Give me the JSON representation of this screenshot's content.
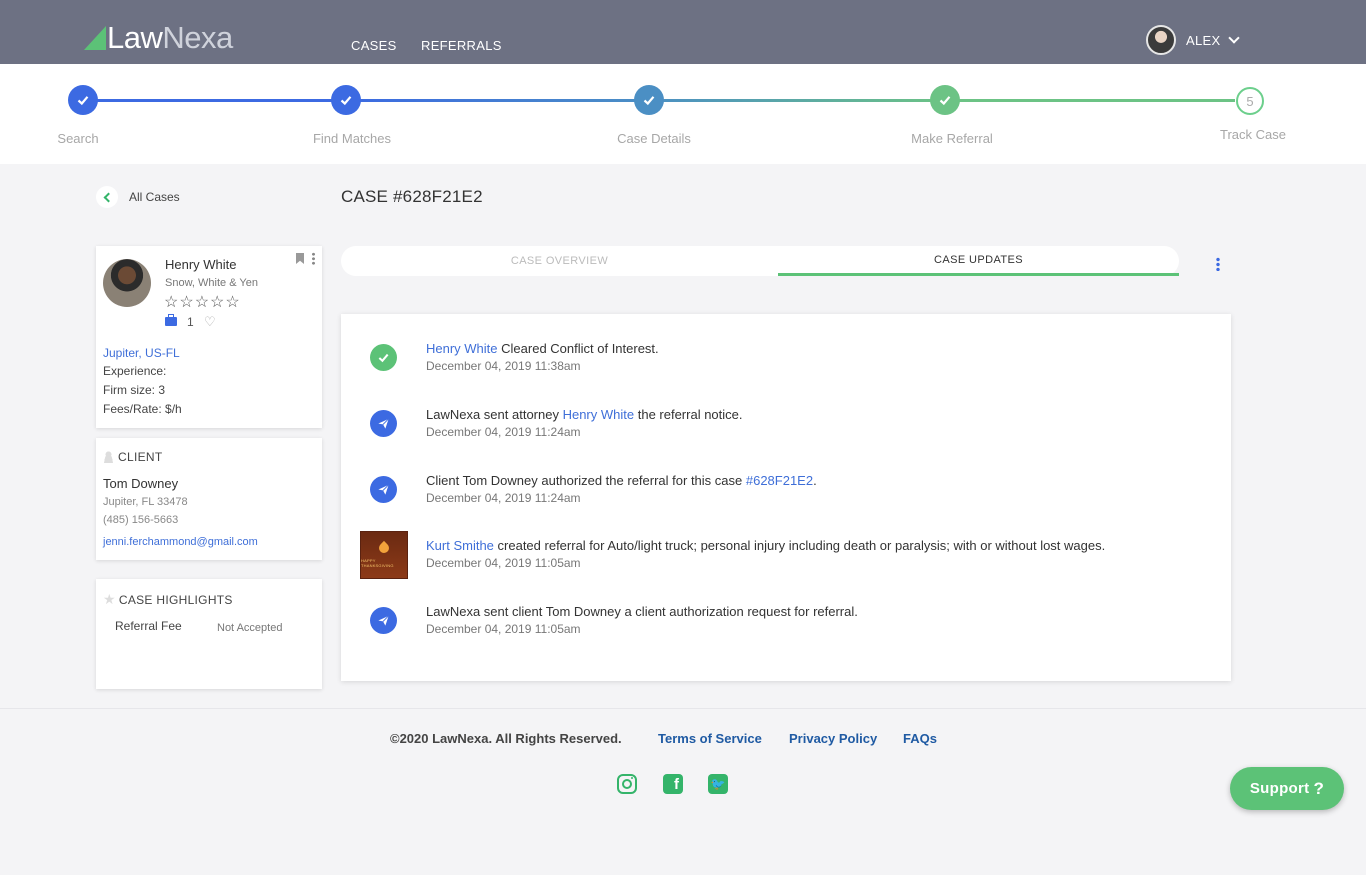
{
  "header": {
    "logo_law": "Law",
    "logo_nexa": "Nexa",
    "nav": [
      "CASES",
      "REFERRALS"
    ],
    "user_name": "ALEX"
  },
  "stepper": {
    "steps": [
      {
        "label": "Search",
        "state": "done"
      },
      {
        "label": "Find Matches",
        "state": "done"
      },
      {
        "label": "Case Details",
        "state": "done"
      },
      {
        "label": "Make Referral",
        "state": "done"
      },
      {
        "label": "Track Case",
        "state": "pending",
        "number": "5"
      }
    ],
    "colors": {
      "blue": "#3c6ae2",
      "teal": "#4b8fc4",
      "green": "#6cc385"
    }
  },
  "back_label": "All Cases",
  "case_title": "CASE #628F21E2",
  "attorney": {
    "name": "Henry White",
    "firm": "Snow, White & Yen",
    "rating_stars": "☆☆☆☆☆",
    "case_count": "1",
    "location": "Jupiter, US-FL",
    "experience": "Experience:",
    "firm_size": "Firm size: 3",
    "fees": "Fees/Rate: $/h"
  },
  "client": {
    "heading": "CLIENT",
    "name": "Tom Downey",
    "address": "Jupiter, FL 33478",
    "phone": "(485) 156-5663",
    "email": "jenni.ferchammond@gmail.com"
  },
  "highlights": {
    "heading": "CASE HIGHLIGHTS",
    "label": "Referral Fee",
    "value": "Not Accepted"
  },
  "tabs": {
    "overview": "CASE OVERVIEW",
    "updates": "CASE UPDATES"
  },
  "updates": [
    {
      "icon": "check-icon",
      "parts": [
        {
          "t": "Henry White",
          "link": true
        },
        {
          "t": " Cleared Conflict of Interest."
        }
      ],
      "date": "December 04, 2019 11:38am"
    },
    {
      "icon": "send-icon",
      "parts": [
        {
          "t": "LawNexa sent attorney "
        },
        {
          "t": "Henry White",
          "link": true
        },
        {
          "t": " the referral notice."
        }
      ],
      "date": "December 04, 2019 11:24am"
    },
    {
      "icon": "send-icon",
      "parts": [
        {
          "t": "Client Tom Downey authorized the referral for this case "
        },
        {
          "t": "#628F21E2",
          "link": true
        },
        {
          "t": "."
        }
      ],
      "date": "December 04, 2019 11:24am"
    },
    {
      "icon": "thumbnail-image",
      "thumb_text": "HAPPY THANKSGIVING",
      "parts": [
        {
          "t": "Kurt Smithe",
          "link": true
        },
        {
          "t": " created referral for Auto/light truck; personal injury including death or paralysis; with or without lost wages."
        }
      ],
      "date": "December 04, 2019 11:05am"
    },
    {
      "icon": "send-icon",
      "parts": [
        {
          "t": "LawNexa sent client Tom Downey a client authorization request for referral."
        }
      ],
      "date": "December 04, 2019 11:05am"
    }
  ],
  "footer": {
    "copyright": "©2020 LawNexa. All Rights Reserved.",
    "terms": "Terms of Service",
    "privacy": "Privacy Policy",
    "faqs": "FAQs",
    "social": [
      "instagram-icon",
      "facebook-icon",
      "twitter-icon"
    ],
    "twitter_glyph": "🐦"
  },
  "support": {
    "label": "Support",
    "glyph": "?"
  }
}
